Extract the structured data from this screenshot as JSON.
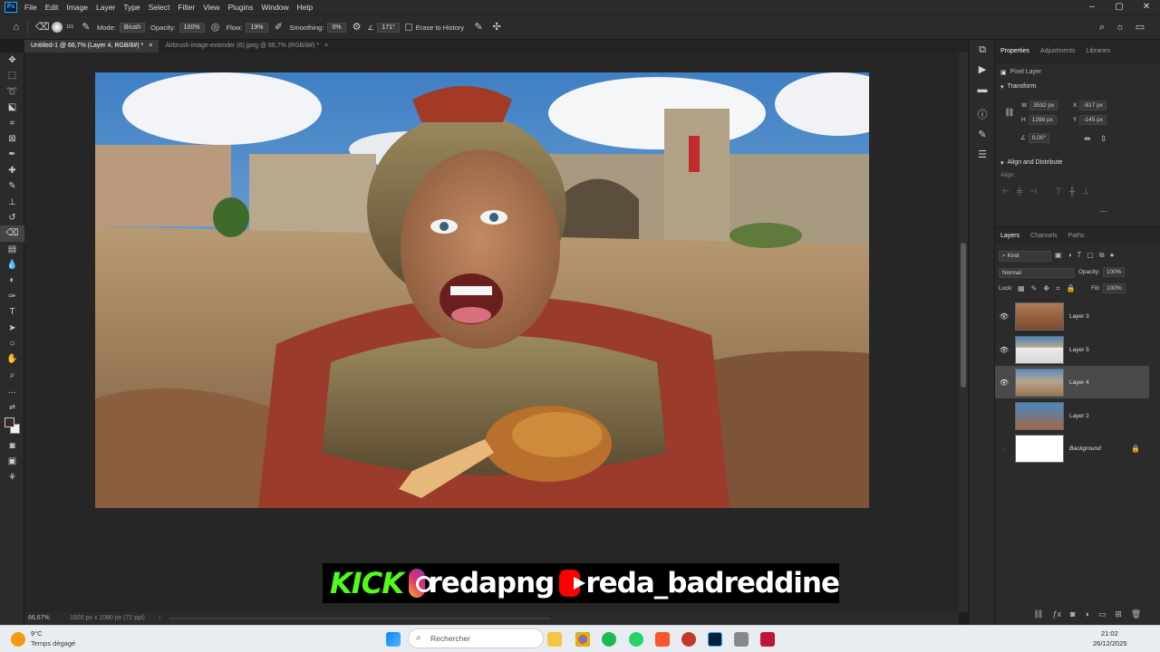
{
  "app": {
    "logo": "Ps"
  },
  "menu": [
    "File",
    "Edit",
    "Image",
    "Layer",
    "Type",
    "Select",
    "Filter",
    "View",
    "Plugins",
    "Window",
    "Help"
  ],
  "window_controls": [
    "–",
    "▢",
    "✕"
  ],
  "options": {
    "brush_size": "116",
    "mode_label": "Mode:",
    "mode_value": "Brush",
    "opacity_label": "Opacity:",
    "opacity_value": "100%",
    "flow_label": "Flow:",
    "flow_value": "19%",
    "smoothing_label": "Smoothing:",
    "smoothing_value": "0%",
    "angle_value": "171°",
    "erase_history": "Erase to History"
  },
  "tabs": [
    {
      "label": "Untitled-1 @ 66,7% (Layer 4, RGB/8#) *",
      "close": "×"
    },
    {
      "label": "Airbrush-image-extender (6).jpeg @ 66,7% (RGB/8#) *",
      "close": "×"
    }
  ],
  "status": {
    "zoom": "66,67%",
    "doc_info": "1920 px x 1080 px (72 ppi)"
  },
  "properties": {
    "tabs": [
      "Properties",
      "Adjustments",
      "Libraries"
    ],
    "layer_type": "Pixel Layer",
    "transform_title": "Transform",
    "w_label": "W",
    "w": "3532 px",
    "h_label": "H",
    "h": "1298 px",
    "x_label": "X",
    "x": "-817 px",
    "y_label": "Y",
    "y": "-145 px",
    "angle": "0,00°",
    "align_title": "Align and Distribute",
    "align_label": "Align:",
    "more": "..."
  },
  "layers_panel": {
    "tabs": [
      "Layers",
      "Channels",
      "Paths"
    ],
    "kind": "Kind",
    "blend_mode": "Normal",
    "opacity_label": "Opacity:",
    "opacity": "100%",
    "lock_label": "Lock:",
    "fill_label": "Fill:",
    "fill": "100%",
    "layers": [
      {
        "name": "Layer 3",
        "visible": true
      },
      {
        "name": "Layer 5",
        "visible": true
      },
      {
        "name": "Layer 4",
        "visible": true,
        "selected": true
      },
      {
        "name": "Layer 2",
        "visible": false
      },
      {
        "name": "Background",
        "visible": false,
        "locked": true
      }
    ]
  },
  "overlay": {
    "kick": "KICK",
    "instagram": "redapng",
    "youtube": "reda_badreddine"
  },
  "taskbar": {
    "weather_temp": "9°C",
    "weather_desc": "Temps dégagé",
    "search_placeholder": "Rechercher",
    "time": "21:02",
    "date": "26/12/2025"
  },
  "colors": {
    "accent": "#31a8ff",
    "kick": "#53fc18"
  }
}
